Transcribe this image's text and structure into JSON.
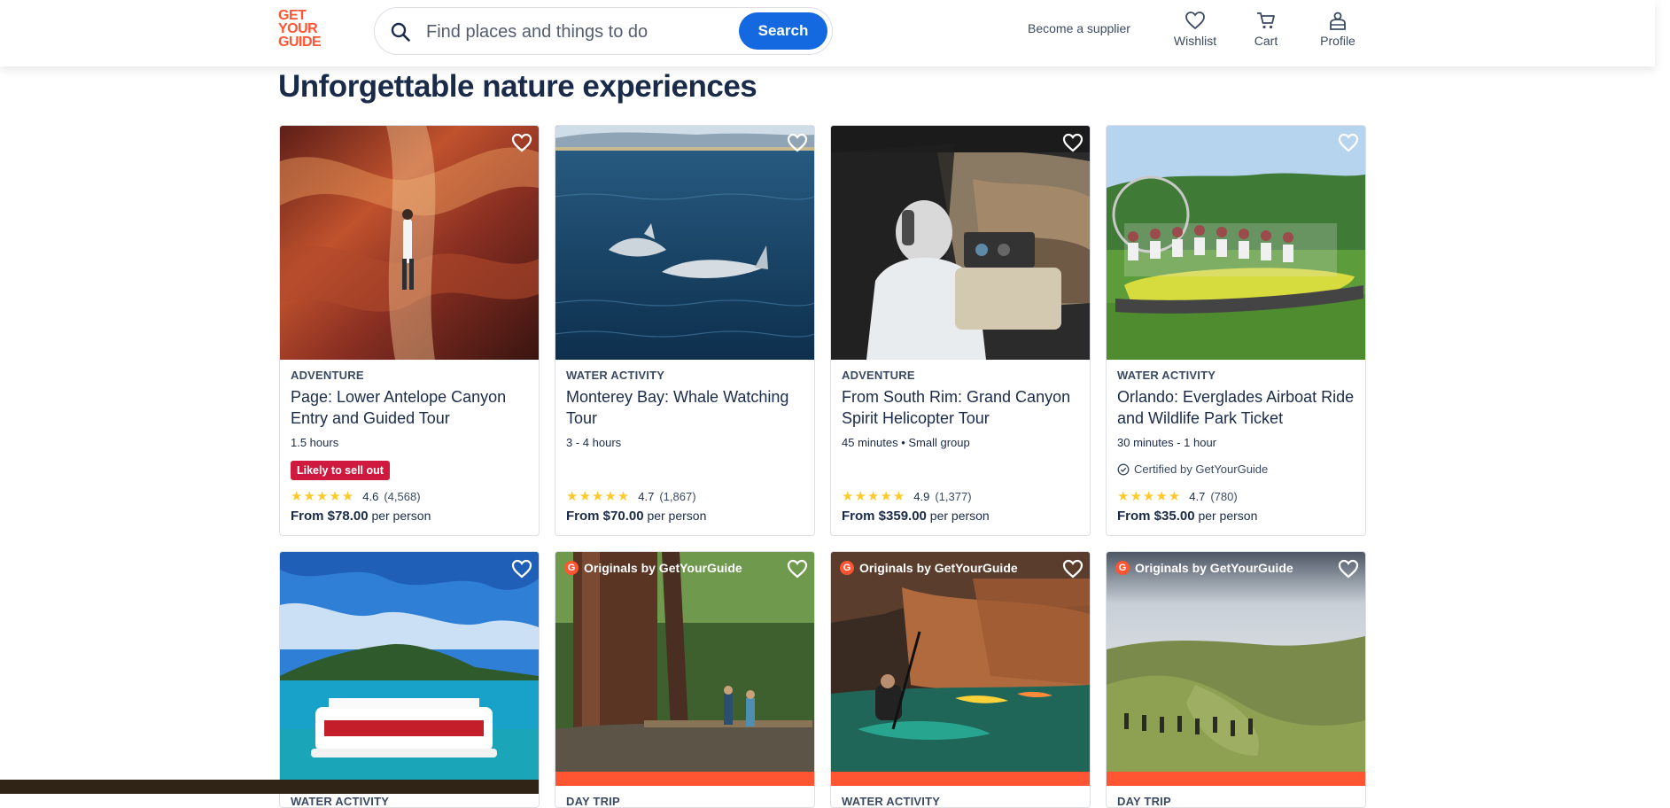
{
  "header": {
    "logo": [
      "GET",
      "YOUR",
      "GUIDE"
    ],
    "search": {
      "placeholder": "Find places and things to do",
      "button": "Search"
    },
    "supplier_link": "Become a supplier",
    "nav": [
      {
        "label": "Wishlist",
        "icon": "heart-icon"
      },
      {
        "label": "Cart",
        "icon": "cart-icon"
      },
      {
        "label": "Profile",
        "icon": "profile-icon"
      }
    ]
  },
  "section": {
    "title": "Unforgettable nature experiences"
  },
  "cards": [
    {
      "category": "ADVENTURE",
      "title": "Page: Lower Antelope Canyon Entry and Guided Tour",
      "meta": "1.5 hours",
      "badge": "Likely to sell out",
      "rating": "4.6",
      "reviews": "(4,568)",
      "price": "From $78.00",
      "per": "per person"
    },
    {
      "category": "WATER ACTIVITY",
      "title": "Monterey Bay: Whale Watching Tour",
      "meta": "3 - 4 hours",
      "rating": "4.7",
      "reviews": "(1,867)",
      "price": "From $70.00",
      "per": "per person"
    },
    {
      "category": "ADVENTURE",
      "title": "From South Rim: Grand Canyon Spirit Helicopter Tour",
      "meta": "45 minutes • Small group",
      "rating": "4.9",
      "reviews": "(1,377)",
      "price": "From $359.00",
      "per": "per person"
    },
    {
      "category": "WATER ACTIVITY",
      "title": "Orlando: Everglades Airboat Ride and Wildlife Park Ticket",
      "meta": "30 minutes - 1 hour",
      "certified": "Certified by GetYourGuide",
      "rating": "4.7",
      "reviews": "(780)",
      "price": "From $35.00",
      "per": "per person"
    },
    {
      "category": "WATER ACTIVITY"
    },
    {
      "originals": "Originals by GetYourGuide",
      "category": "DAY TRIP"
    },
    {
      "originals": "Originals by GetYourGuide",
      "category": "WATER ACTIVITY"
    },
    {
      "originals": "Originals by GetYourGuide",
      "category": "DAY TRIP"
    }
  ],
  "colors": {
    "brand": "#ff5533",
    "primary": "#1468e0",
    "badge": "#d0193f",
    "star": "#fdc92b"
  }
}
